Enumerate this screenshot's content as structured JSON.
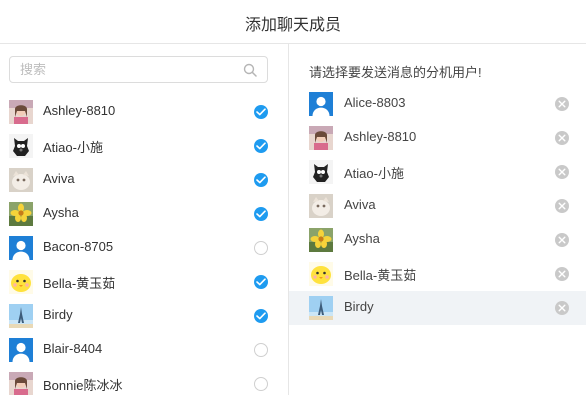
{
  "dialog": {
    "title": "添加聊天成员"
  },
  "search": {
    "placeholder": "搜索",
    "icon": "search-icon"
  },
  "contacts": [
    {
      "name": "Ashley-8810",
      "avatar": "photo-woman",
      "checked": true
    },
    {
      "name": "Atiao-小施",
      "avatar": "photo-dog",
      "checked": true
    },
    {
      "name": "Aviva",
      "avatar": "photo-cat",
      "checked": true
    },
    {
      "name": "Aysha",
      "avatar": "photo-flower",
      "checked": true
    },
    {
      "name": "Bacon-8705",
      "avatar": "default-user",
      "checked": false
    },
    {
      "name": "Bella-黄玉茹",
      "avatar": "photo-chick",
      "checked": true
    },
    {
      "name": "Birdy",
      "avatar": "photo-tower",
      "checked": true
    },
    {
      "name": "Blair-8404",
      "avatar": "default-user",
      "checked": false
    },
    {
      "name": "Bonnie陈冰冰",
      "avatar": "photo-woman",
      "checked": false
    }
  ],
  "selected": {
    "hint": "请选择要发送消息的分机用户!",
    "users": [
      {
        "name": "Alice-8803",
        "avatar": "default-user"
      },
      {
        "name": "Ashley-8810",
        "avatar": "photo-woman"
      },
      {
        "name": "Atiao-小施",
        "avatar": "photo-dog"
      },
      {
        "name": "Aviva",
        "avatar": "photo-cat"
      },
      {
        "name": "Aysha",
        "avatar": "photo-flower"
      },
      {
        "name": "Bella-黄玉茹",
        "avatar": "photo-chick"
      },
      {
        "name": "Birdy",
        "avatar": "photo-tower"
      }
    ],
    "highlighted": "Birdy"
  },
  "colors": {
    "check": "#1e9bf0",
    "default_avatar": "#1e7fd6",
    "remove": "#c9c9c9",
    "row_highlight": "#f0f3f6"
  }
}
